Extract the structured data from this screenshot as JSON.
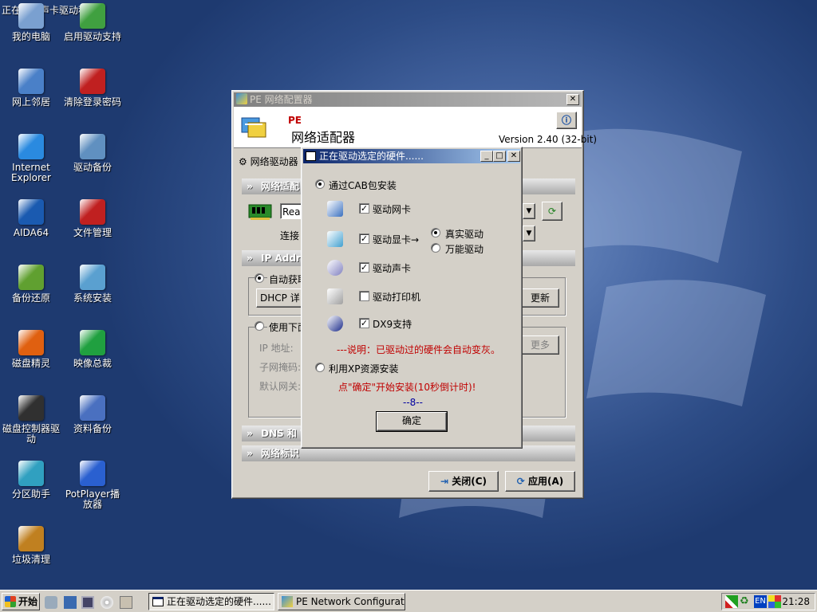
{
  "desktop": {
    "top_text": "正在安装声卡驱动程序",
    "icons": [
      {
        "label": "我的电脑",
        "icon": "my-computer-icon"
      },
      {
        "label": "启用驱动支持",
        "icon": "driver-support-icon"
      },
      {
        "label": "网上邻居",
        "icon": "network-places-icon"
      },
      {
        "label": "清除登录密码",
        "icon": "clear-password-icon"
      },
      {
        "label": "Internet Explorer",
        "icon": "internet-explorer-icon"
      },
      {
        "label": "驱动备份",
        "icon": "driver-backup-icon"
      },
      {
        "label": "AIDA64",
        "icon": "aida64-icon"
      },
      {
        "label": "文件管理",
        "icon": "file-manager-icon"
      },
      {
        "label": "备份还原",
        "icon": "backup-restore-icon"
      },
      {
        "label": "系统安装",
        "icon": "system-install-icon"
      },
      {
        "label": "磁盘精灵",
        "icon": "disk-genius-icon"
      },
      {
        "label": "映像总裁",
        "icon": "image-master-icon"
      },
      {
        "label": "磁盘控制器驱动",
        "icon": "disk-controller-icon"
      },
      {
        "label": "资料备份",
        "icon": "data-backup-icon"
      },
      {
        "label": "分区助手",
        "icon": "partition-assistant-icon"
      },
      {
        "label": "PotPlayer播放器",
        "icon": "potplayer-icon"
      },
      {
        "label": "垃圾清理",
        "icon": "junk-cleaner-icon"
      }
    ]
  },
  "netwin": {
    "title": "PE 网络配置器",
    "header_pe": "PE",
    "header_title": "网络适配器",
    "version": "Version 2.40 (32-bit)",
    "toolbar_label": "网络驱动器",
    "sect_adapter": "网络适配",
    "adapter_value": "Real",
    "connect_label": "连接",
    "sect_ip": "IP Addre",
    "radio_auto": "自动获取",
    "dhcp_label": "DHCP 详",
    "refresh_btn": "更新",
    "radio_manual": "使用下面",
    "ip_label": "IP 地址:",
    "mask_label": "子网掩码:",
    "gateway_label": "默认网关:",
    "more_btn": "更多",
    "sect_dns": "DNS 和 W",
    "sect_netid": "网络标识",
    "close_btn": "关闭(C)",
    "apply_btn": "应用(A)"
  },
  "dialog": {
    "title": "正在驱动选定的硬件......",
    "opt_cab": "通过CAB包安装",
    "items": [
      {
        "label": "驱动网卡",
        "checked": true,
        "icon": "network-card-icon"
      },
      {
        "label": "驱动显卡→",
        "checked": true,
        "icon": "display-card-icon"
      },
      {
        "label": "驱动声卡",
        "checked": true,
        "icon": "sound-card-icon"
      },
      {
        "label": "驱动打印机",
        "checked": false,
        "icon": "printer-icon"
      },
      {
        "label": "DX9支持",
        "checked": true,
        "icon": "directx-icon"
      }
    ],
    "display_real": "真实驱动",
    "display_universal": "万能驱动",
    "note": "---说明：已驱动过的硬件会自动变灰。",
    "opt_xp": "利用XP资源安装",
    "prompt": "点\"确定\"开始安装(10秒倒计时)!",
    "countdown": "--8--",
    "ok_btn": "确定"
  },
  "taskbar": {
    "start": "开始",
    "task1": "正在驱动选定的硬件......",
    "task2": "PE Network Configurator",
    "tray_lang": "EN",
    "clock": "21:28"
  }
}
